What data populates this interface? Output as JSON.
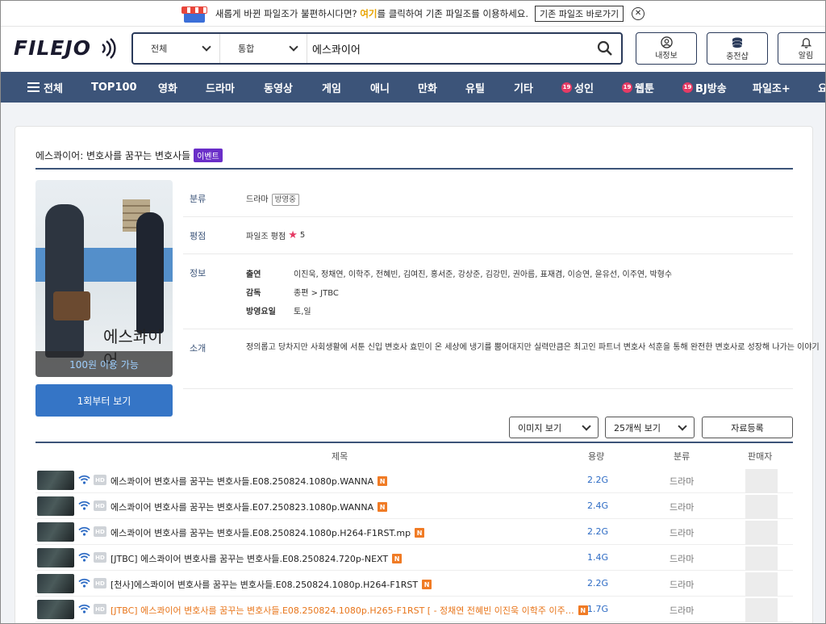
{
  "banner": {
    "text_before": "새롭게 바뀐 파일조가 불편하시다면?",
    "highlight": "여기",
    "text_after": "를 클릭하여 기존 파일조를 이용하세요.",
    "button": "기존 파일조 바로가기",
    "close": "✕"
  },
  "header": {
    "logo": "FILEJO",
    "search": {
      "scope": "전체",
      "type": "통합",
      "query": "에스콰이어"
    },
    "buttons": {
      "mypage": "내정보",
      "charge": "충전샵",
      "alarm": "알림"
    }
  },
  "nav": {
    "all": "전체",
    "items": [
      "TOP100",
      "영화",
      "드라마",
      "동영상",
      "게임",
      "애니",
      "만화",
      "유틸",
      "기타"
    ],
    "adult": [
      "성인",
      "웹툰",
      "BJ방송"
    ],
    "plus": "파일조+",
    "cut": "요",
    "badge19": "19"
  },
  "content": {
    "title": "에스콰이어: 변호사를 꿈꾸는 변호사들",
    "event_badge": "이벤트",
    "poster": {
      "title": "에스콰이어",
      "availability": "100원 이용 가능"
    },
    "watch_button": "1회부터 보기",
    "info": {
      "category_label": "분류",
      "category_value": "드라마",
      "category_tag": "방영중",
      "rating_label": "평점",
      "rating_text": "파일조 평점",
      "rating_value": "5",
      "info_label": "정보",
      "cast_label": "출연",
      "cast_value": "이진욱, 정채연, 이학주, 전혜빈, 김여진, 홍서준, 강상준, 김강민, 권아름, 표재겸, 이승연, 윤유선, 이주연, 박형수",
      "director_label": "감독",
      "director_value": "종편 > JTBC",
      "airday_label": "방영요일",
      "airday_value": "토,일",
      "intro_label": "소개",
      "intro_value": "정의롭고 당차지만 사회생활에 서툰 신입 변호사 효민이 온 세상에 냉기를 뿜어대지만 실력만큼은 최고인 파트너 변호사 석훈을 통해 완전한 변호사로 성장해 나가는 이야기"
    },
    "controls": {
      "view": "이미지 보기",
      "per_page": "25개씩 보기",
      "register": "자료등록"
    },
    "table": {
      "headers": {
        "title": "제목",
        "size": "용량",
        "category": "분류",
        "seller": "판매자"
      },
      "rows": [
        {
          "hd": "HD",
          "title": "에스콰이어 변호사를 꿈꾸는 변호사들.E08.250824.1080p.WANNA",
          "size": "2.2G",
          "category": "드라마",
          "hot": false
        },
        {
          "hd": "HD",
          "title": "에스콰이어 변호사를 꿈꾸는 변호사들.E07.250823.1080p.WANNA",
          "size": "2.4G",
          "category": "드라마",
          "hot": false
        },
        {
          "hd": "HD",
          "title": "에스콰이어 변호사를 꿈꾸는 변호사들.E08.250824.1080p.H264-F1RST.mp",
          "size": "2.2G",
          "category": "드라마",
          "hot": false
        },
        {
          "hd": "HD",
          "title": "[JTBC] 에스콰이어 변호사를 꿈꾸는 변호사들.E08.250824.720p-NEXT",
          "size": "1.4G",
          "category": "드라마",
          "hot": false
        },
        {
          "hd": "HD",
          "title": "[천사]에스콰이어 변호사를 꿈꾸는 변호사들.E08.250824.1080p.H264-F1RST",
          "size": "2.2G",
          "category": "드라마",
          "hot": false
        },
        {
          "hd": "HD",
          "title": "[JTBC] 에스콰이어 변호사를 꿈꾸는 변호사들.E08.250824.1080p.H265-F1RST [ - 정채연 전혜빈 이진욱 이학주 이주…",
          "size": "1.7G",
          "category": "드라마",
          "hot": true
        }
      ],
      "new_badge": "N"
    }
  },
  "colors": {
    "nav": "#3c5479",
    "accent": "#3575c6",
    "event": "#6a2ec8",
    "new": "#f07b25",
    "adult": "#e53a64",
    "hot_title": "#e8751a"
  }
}
